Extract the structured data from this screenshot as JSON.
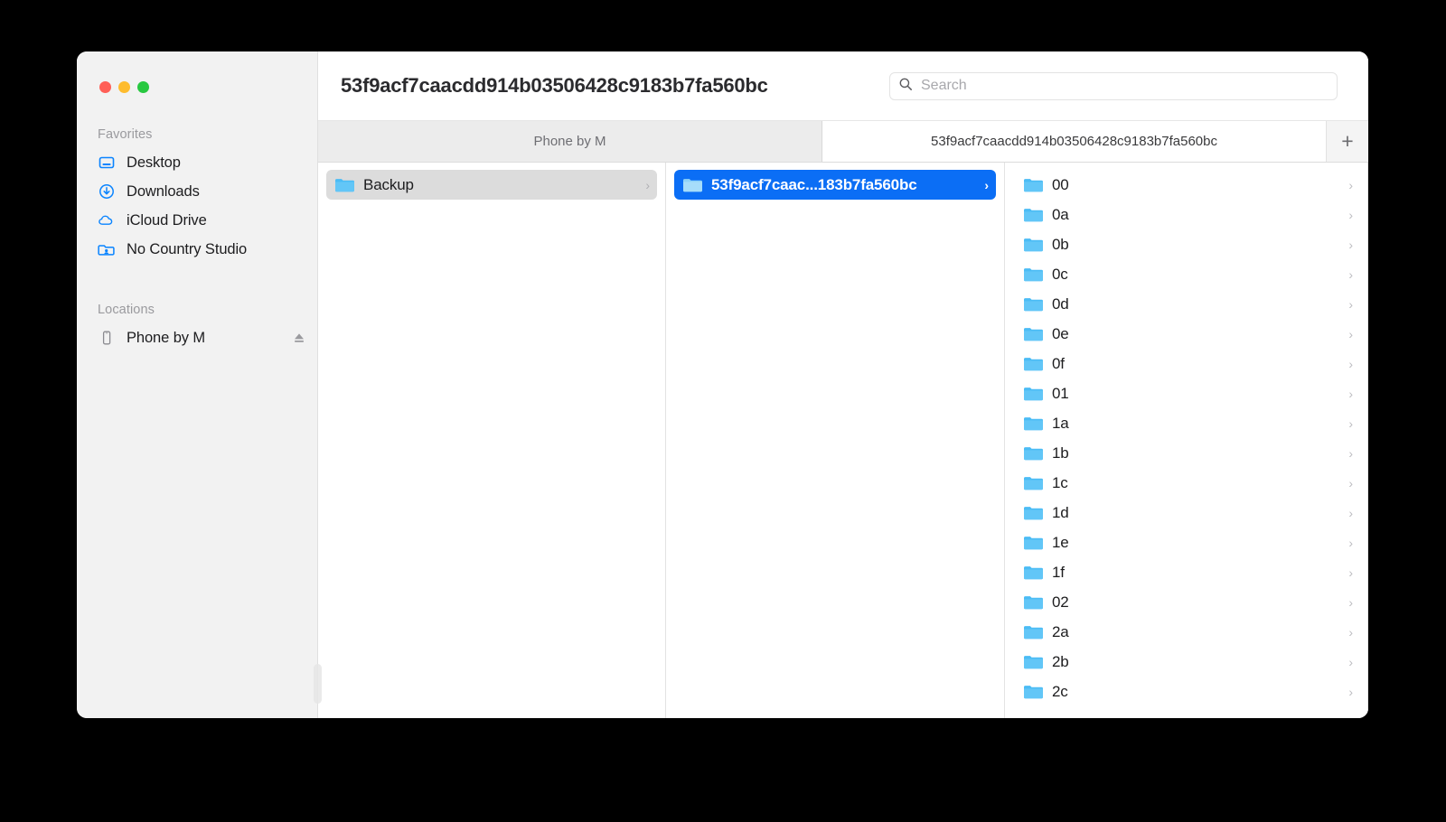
{
  "window": {
    "title": "53f9acf7caacdd914b03506428c9183b7fa560bc",
    "traffic_lights": {
      "close": "close-button",
      "minimize": "minimize-button",
      "maximize": "maximize-button"
    }
  },
  "search": {
    "placeholder": "Search",
    "value": "",
    "icon": "search-icon"
  },
  "sidebar": {
    "sections": [
      {
        "heading": "Favorites",
        "items": [
          {
            "label": "Desktop",
            "icon": "desktop-icon"
          },
          {
            "label": "Downloads",
            "icon": "downloads-icon"
          },
          {
            "label": "iCloud Drive",
            "icon": "icloud-drive-icon"
          },
          {
            "label": "No Country Studio",
            "icon": "folder-user-icon"
          }
        ]
      },
      {
        "heading": "Locations",
        "items": [
          {
            "label": "Phone by M",
            "icon": "iphone-icon",
            "eject": "eject-icon"
          }
        ]
      }
    ]
  },
  "tabbar": {
    "tabs": [
      {
        "label": "Phone by M",
        "active": false
      },
      {
        "label": "53f9acf7caacdd914b03506428c9183b7fa560bc",
        "active": true
      }
    ],
    "add_tab_label": "+"
  },
  "columns": [
    {
      "name": "column-backup",
      "rows": [
        {
          "label": "Backup",
          "selected": "gray",
          "chevron": "›",
          "icon": "folder-icon"
        }
      ]
    },
    {
      "name": "column-backup-uuid",
      "rows": [
        {
          "label": "53f9acf7caac...183b7fa560bc",
          "selected": "blue",
          "chevron": "›",
          "icon": "folder-icon"
        }
      ]
    },
    {
      "name": "column-hash-buckets",
      "rows": [
        {
          "label": "00",
          "selected": "none",
          "chevron": "›",
          "icon": "folder-icon"
        },
        {
          "label": "0a",
          "selected": "none",
          "chevron": "›",
          "icon": "folder-icon"
        },
        {
          "label": "0b",
          "selected": "none",
          "chevron": "›",
          "icon": "folder-icon"
        },
        {
          "label": "0c",
          "selected": "none",
          "chevron": "›",
          "icon": "folder-icon"
        },
        {
          "label": "0d",
          "selected": "none",
          "chevron": "›",
          "icon": "folder-icon"
        },
        {
          "label": "0e",
          "selected": "none",
          "chevron": "›",
          "icon": "folder-icon"
        },
        {
          "label": "0f",
          "selected": "none",
          "chevron": "›",
          "icon": "folder-icon"
        },
        {
          "label": "01",
          "selected": "none",
          "chevron": "›",
          "icon": "folder-icon"
        },
        {
          "label": "1a",
          "selected": "none",
          "chevron": "›",
          "icon": "folder-icon"
        },
        {
          "label": "1b",
          "selected": "none",
          "chevron": "›",
          "icon": "folder-icon"
        },
        {
          "label": "1c",
          "selected": "none",
          "chevron": "›",
          "icon": "folder-icon"
        },
        {
          "label": "1d",
          "selected": "none",
          "chevron": "›",
          "icon": "folder-icon"
        },
        {
          "label": "1e",
          "selected": "none",
          "chevron": "›",
          "icon": "folder-icon"
        },
        {
          "label": "1f",
          "selected": "none",
          "chevron": "›",
          "icon": "folder-icon"
        },
        {
          "label": "02",
          "selected": "none",
          "chevron": "›",
          "icon": "folder-icon"
        },
        {
          "label": "2a",
          "selected": "none",
          "chevron": "›",
          "icon": "folder-icon"
        },
        {
          "label": "2b",
          "selected": "none",
          "chevron": "›",
          "icon": "folder-icon"
        },
        {
          "label": "2c",
          "selected": "none",
          "chevron": "›",
          "icon": "folder-icon"
        }
      ]
    }
  ],
  "colors": {
    "selection_blue": "#0b6ef5",
    "selection_gray": "#dcdcdc",
    "folder_blue": "#54bdf4",
    "accent_blue": "#0a84ff",
    "sidebar_bg": "#f2f2f2",
    "tabbar_bg": "#ececec"
  }
}
